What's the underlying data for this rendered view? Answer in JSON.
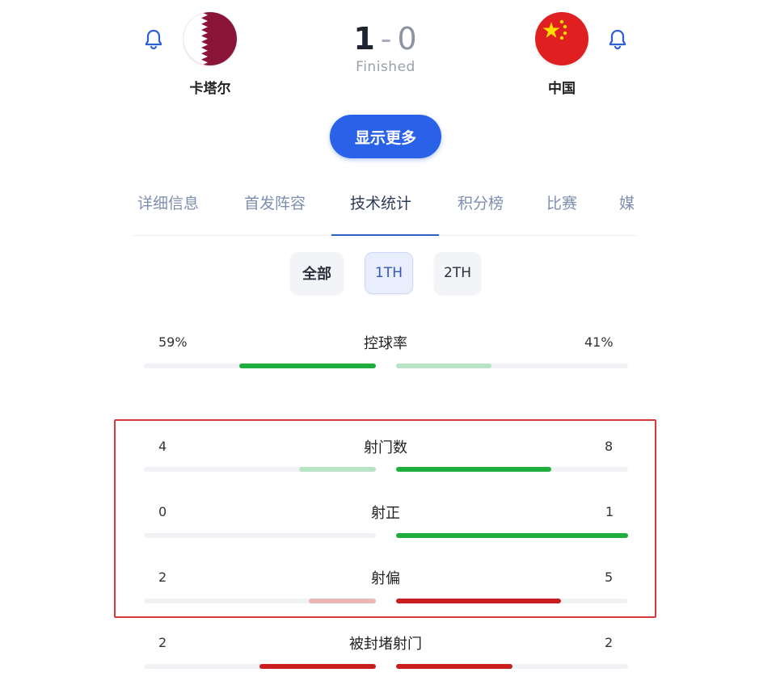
{
  "match": {
    "home": {
      "name": "卡塔尔"
    },
    "away": {
      "name": "中国"
    },
    "score": {
      "home": "1",
      "separator": "-",
      "away": "0"
    },
    "status": "Finished"
  },
  "show_more_label": "显示更多",
  "tabs": [
    {
      "label": "详细信息"
    },
    {
      "label": "首发阵容"
    },
    {
      "label": "技术统计"
    },
    {
      "label": "积分榜"
    },
    {
      "label": "比赛"
    },
    {
      "label": "媒"
    }
  ],
  "active_tab": 2,
  "periods": [
    {
      "label": "全部"
    },
    {
      "label": "1TH"
    },
    {
      "label": "2TH"
    }
  ],
  "selected_period": 1,
  "colors": {
    "accent": "#2962e8",
    "green": "#1fae3e",
    "green_light": "#b8e3c4",
    "red": "#c81e1e",
    "red_light": "#eab8b8"
  },
  "stats": [
    {
      "label": "控球率",
      "home": "59%",
      "away": "41%",
      "home_fraction": 0.59,
      "away_fraction": 0.41,
      "home_color": "#1fae3e",
      "away_color": "#b8e3c4"
    },
    {
      "label": "射门数",
      "home": "4",
      "away": "8",
      "home_fraction": 0.33,
      "away_fraction": 0.67,
      "home_color": "#b8e3c4",
      "away_color": "#1fae3e"
    },
    {
      "label": "射正",
      "home": "0",
      "away": "1",
      "home_fraction": 0.0,
      "away_fraction": 1.0,
      "home_color": "#b8e3c4",
      "away_color": "#1fae3e"
    },
    {
      "label": "射偏",
      "home": "2",
      "away": "5",
      "home_fraction": 0.29,
      "away_fraction": 0.71,
      "home_color": "#eab8b8",
      "away_color": "#c81e1e"
    },
    {
      "label": "被封堵射门",
      "home": "2",
      "away": "2",
      "home_fraction": 0.5,
      "away_fraction": 0.5,
      "home_color": "#c81e1e",
      "away_color": "#c81e1e"
    }
  ]
}
